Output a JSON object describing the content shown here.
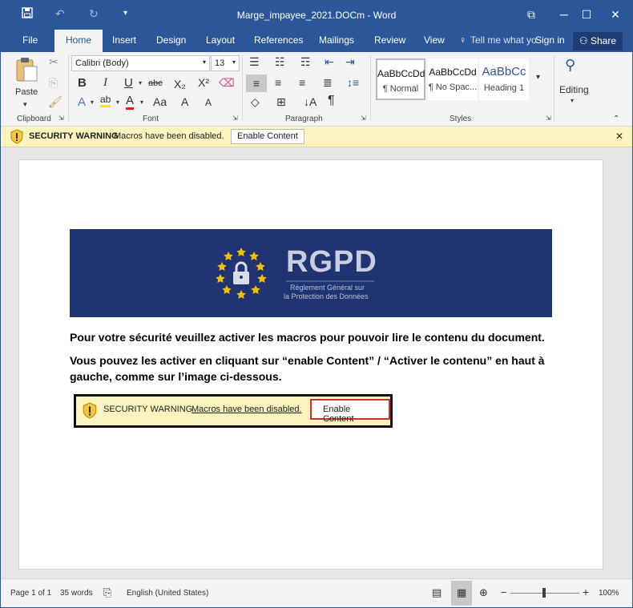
{
  "window": {
    "title": "Marge_impayee_2021.DOCm - Word"
  },
  "qat": {
    "save_icon": "save-icon",
    "undo_icon": "undo-icon",
    "redo_icon": "redo-icon",
    "customize_icon": "customize-icon"
  },
  "controls": {
    "minimize": "─",
    "maximize": "☐",
    "close": "✕",
    "ribbon_display": "⧉"
  },
  "tabs": [
    "File",
    "Home",
    "Insert",
    "Design",
    "Layout",
    "References",
    "Mailings",
    "Review",
    "View"
  ],
  "tell_me": "Tell me what yo",
  "sign_in": "Sign in",
  "share": "Share",
  "ribbon": {
    "clipboard": {
      "paste": "Paste",
      "label": "Clipboard"
    },
    "font": {
      "name": "Calibri (Body)",
      "size": "13",
      "label": "Font",
      "bold": "B",
      "italic": "I",
      "underline": "U",
      "strike": "abc",
      "sub": "X₂",
      "sup": "X²",
      "grow": "A",
      "shrink": "A",
      "case": "Aa"
    },
    "paragraph": {
      "label": "Paragraph",
      "pilcrow": "¶"
    },
    "styles": {
      "label": "Styles",
      "items": [
        {
          "sample": "AaBbCcDd",
          "name": "¶ Normal"
        },
        {
          "sample": "AaBbCcDd",
          "name": "¶ No Spac..."
        },
        {
          "sample": "AaBbCc",
          "name": "Heading 1"
        }
      ]
    },
    "editing": {
      "label": "Editing"
    }
  },
  "security_bar": {
    "title": "SECURITY WARNING",
    "message": "Macros have been disabled.",
    "button": "Enable Content"
  },
  "document": {
    "banner_title": "RGPD",
    "banner_sub1": "Règlement Général sur",
    "banner_sub2": "la Protection des Données",
    "p1": "Pour votre sécurité veuillez activer les macros pour pouvoir lire le contenu du document.",
    "p2": "Vous pouvez les activer en cliquant sur “enable Content” / “Activer le contenu” en haut à gauche, comme sur l’image ci-dessous.",
    "demo_title": "SECURITY WARNING",
    "demo_message": "Macros have been disabled.",
    "demo_button": "Enable Content"
  },
  "status": {
    "page": "Page 1 of 1",
    "words": "35 words",
    "language": "English (United States)",
    "zoom": "100%",
    "zoom_minus": "−",
    "zoom_plus": "+"
  },
  "colors": {
    "accent": "#2b579a",
    "warning_bg": "#fcf4be",
    "banner": "#1f3470",
    "stars": "#f2c200"
  }
}
